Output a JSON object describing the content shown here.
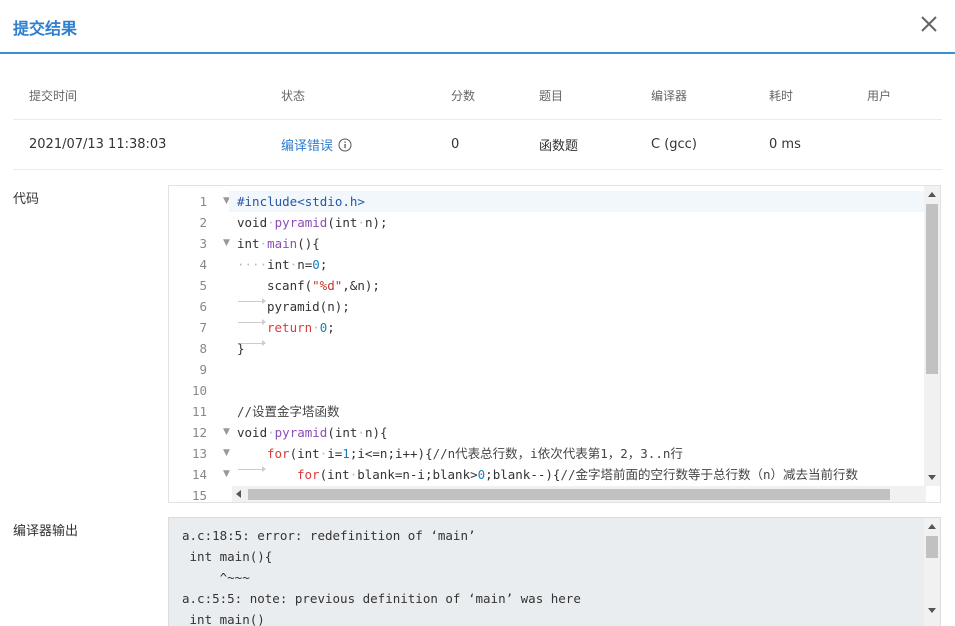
{
  "dialog": {
    "title": "提交结果"
  },
  "table": {
    "headers": [
      "提交时间",
      "状态",
      "分数",
      "题目",
      "编译器",
      "耗时",
      "用户"
    ],
    "row": {
      "time": "2021/07/13 11:38:03",
      "status": "编译错误",
      "score": "0",
      "problem": "函数题",
      "compiler": "C (gcc)",
      "duration": "0 ms",
      "user": ""
    }
  },
  "code_label": "代码",
  "code_lines": [
    "#include<stdio.h>",
    "void pyramid(int n);",
    "int main(){",
    "    int n=0;",
    "\tscanf(\"%d\",&n);",
    "\tpyramid(n);",
    "\treturn 0;",
    "}",
    "",
    "",
    "//设置金字塔函数",
    "void pyramid(int n){",
    "\tfor(int i=1;i<=n;i++){//n代表总行数，i依次代表第1，2，3..n行",
    "\t\tfor(int blank=n-i;blank>0;blank--){//金字塔前面的空行数等于总行数（n）减去当前行数",
    ""
  ],
  "line_numbers": [
    "1",
    "2",
    "3",
    "4",
    "5",
    "6",
    "7",
    "8",
    "9",
    "10",
    "11",
    "12",
    "13",
    "14",
    "15"
  ],
  "output_label": "编译器输出",
  "compiler_output": [
    "a.c:18:5: error: redefinition of ‘main’",
    " int main(){",
    "     ^~~~",
    "a.c:5:5: note: previous definition of ‘main’ was here",
    " int main()"
  ],
  "colors": {
    "accent": "#2f7fd0",
    "output_bg": "#eaedf0"
  }
}
